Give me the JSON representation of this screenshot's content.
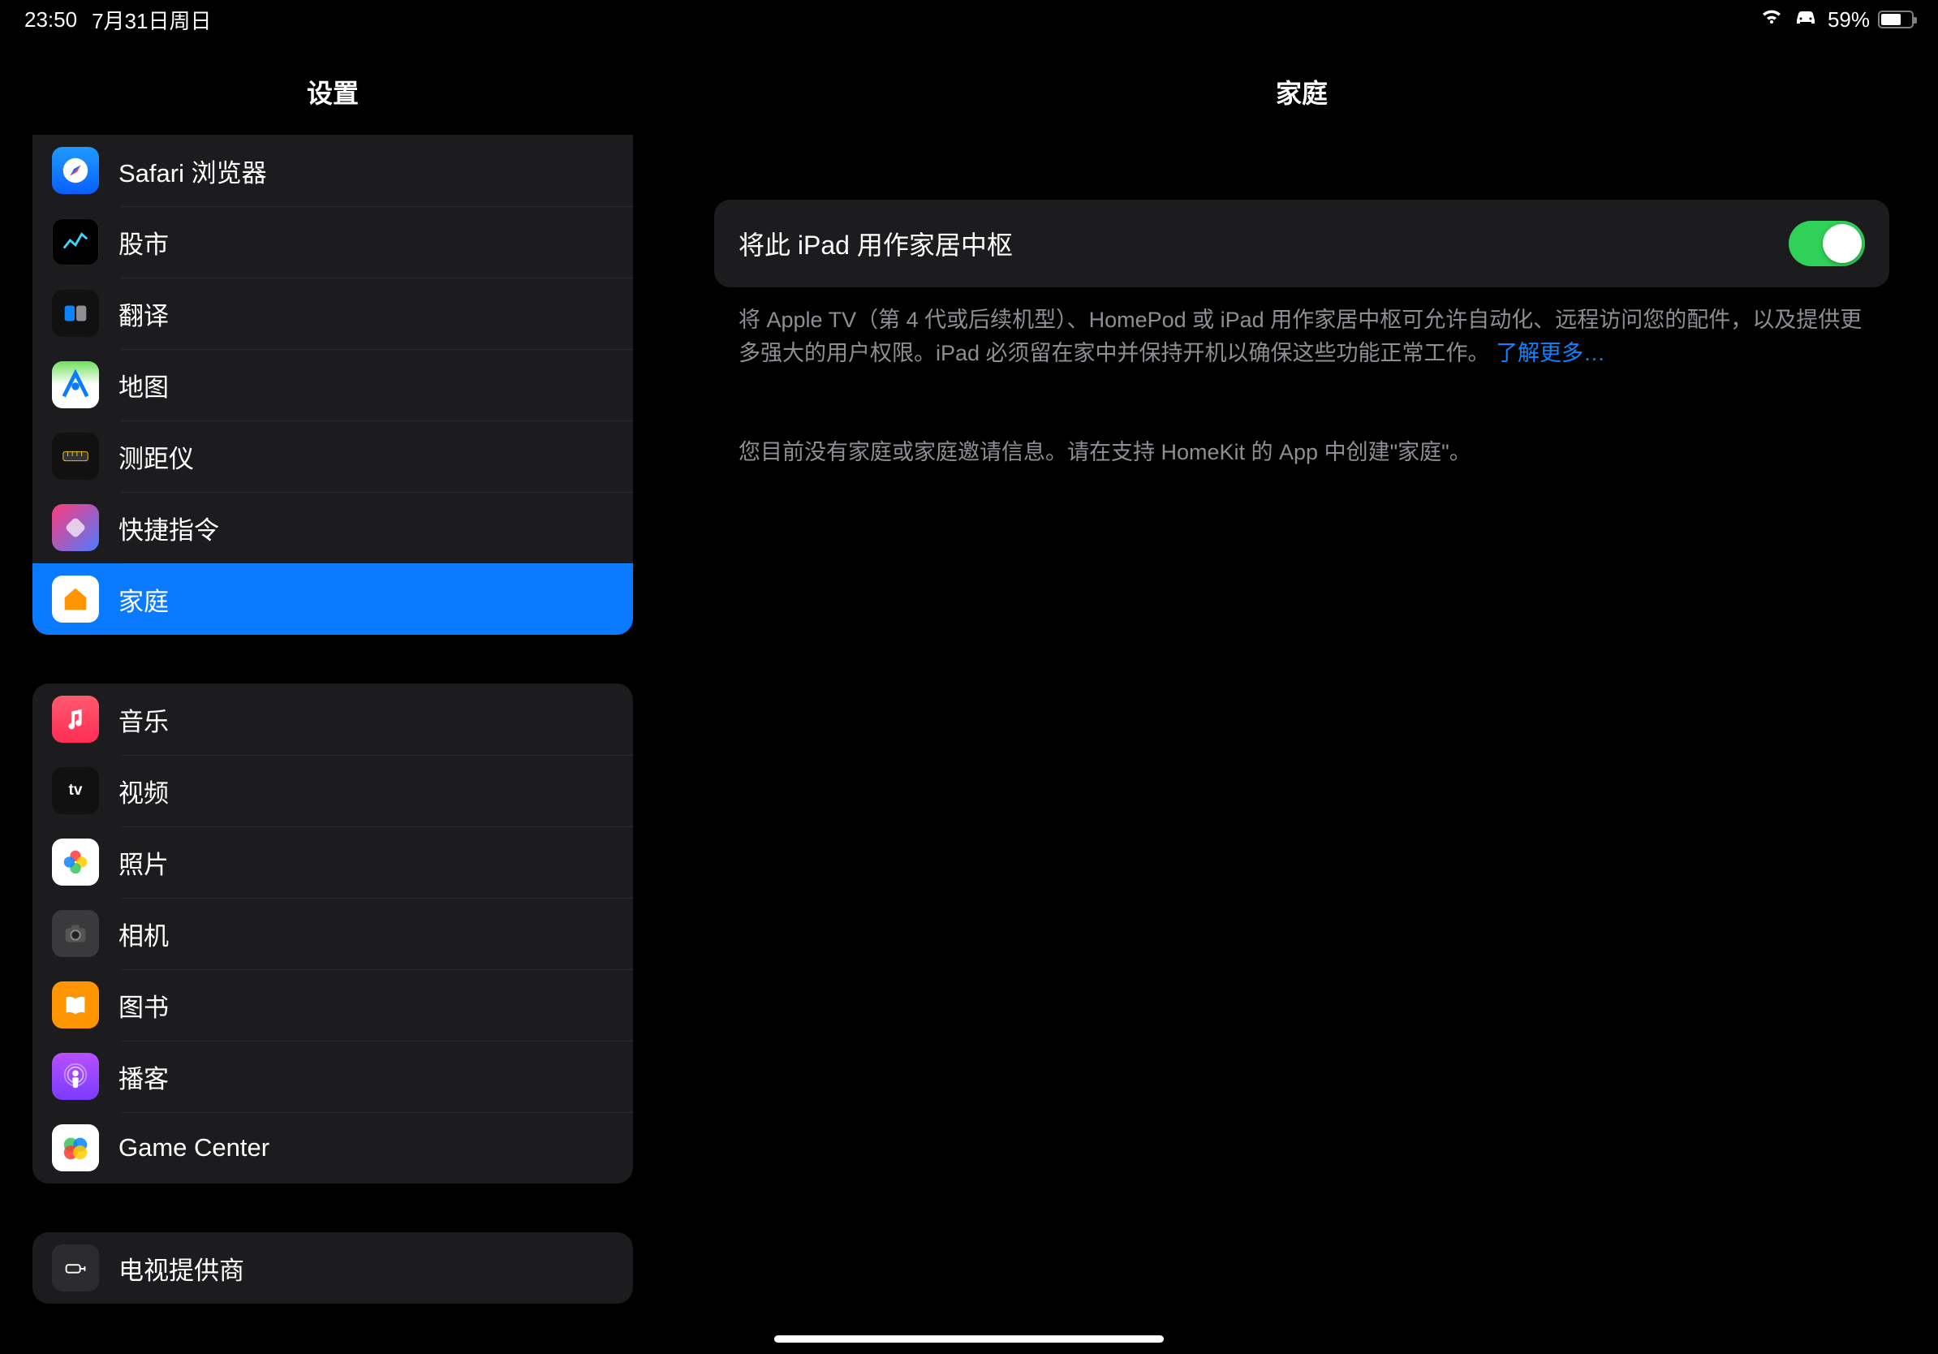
{
  "status": {
    "time": "23:50",
    "date": "7月31日周日",
    "battery_pct": "59%"
  },
  "sidebar": {
    "title": "设置",
    "groups": [
      {
        "id": "apps1",
        "items": [
          {
            "id": "safari",
            "label": "Safari 浏览器",
            "icon": "safari-icon"
          },
          {
            "id": "stocks",
            "label": "股市",
            "icon": "stocks-icon"
          },
          {
            "id": "translate",
            "label": "翻译",
            "icon": "translate-icon"
          },
          {
            "id": "maps",
            "label": "地图",
            "icon": "maps-icon"
          },
          {
            "id": "measure",
            "label": "测距仪",
            "icon": "measure-icon"
          },
          {
            "id": "shortcuts",
            "label": "快捷指令",
            "icon": "shortcuts-icon"
          },
          {
            "id": "home",
            "label": "家庭",
            "icon": "home-icon",
            "selected": true
          }
        ]
      },
      {
        "id": "apps2",
        "items": [
          {
            "id": "music",
            "label": "音乐",
            "icon": "music-icon"
          },
          {
            "id": "tv",
            "label": "视频",
            "icon": "tv-icon"
          },
          {
            "id": "photos",
            "label": "照片",
            "icon": "photos-icon"
          },
          {
            "id": "camera",
            "label": "相机",
            "icon": "camera-icon"
          },
          {
            "id": "books",
            "label": "图书",
            "icon": "books-icon"
          },
          {
            "id": "podcasts",
            "label": "播客",
            "icon": "podcasts-icon"
          },
          {
            "id": "gamecenter",
            "label": "Game Center",
            "icon": "gamecenter-icon"
          }
        ]
      },
      {
        "id": "apps3",
        "items": [
          {
            "id": "tvprovider",
            "label": "电视提供商",
            "icon": "tvprovider-icon"
          }
        ]
      }
    ]
  },
  "detail": {
    "title": "家庭",
    "hub_toggle_label": "将此 iPad 用作家居中枢",
    "hub_toggle_on": true,
    "hub_footer": "将 Apple TV（第 4 代或后续机型）、HomePod 或 iPad 用作家居中枢可允许自动化、远程访问您的配件，以及提供更多强大的用户权限。iPad 必须留在家中并保持开机以确保这些功能正常工作。",
    "hub_footer_link": "了解更多…",
    "no_home_note": "您目前没有家庭或家庭邀请信息。请在支持 HomeKit 的 App 中创建\"家庭\"。"
  }
}
